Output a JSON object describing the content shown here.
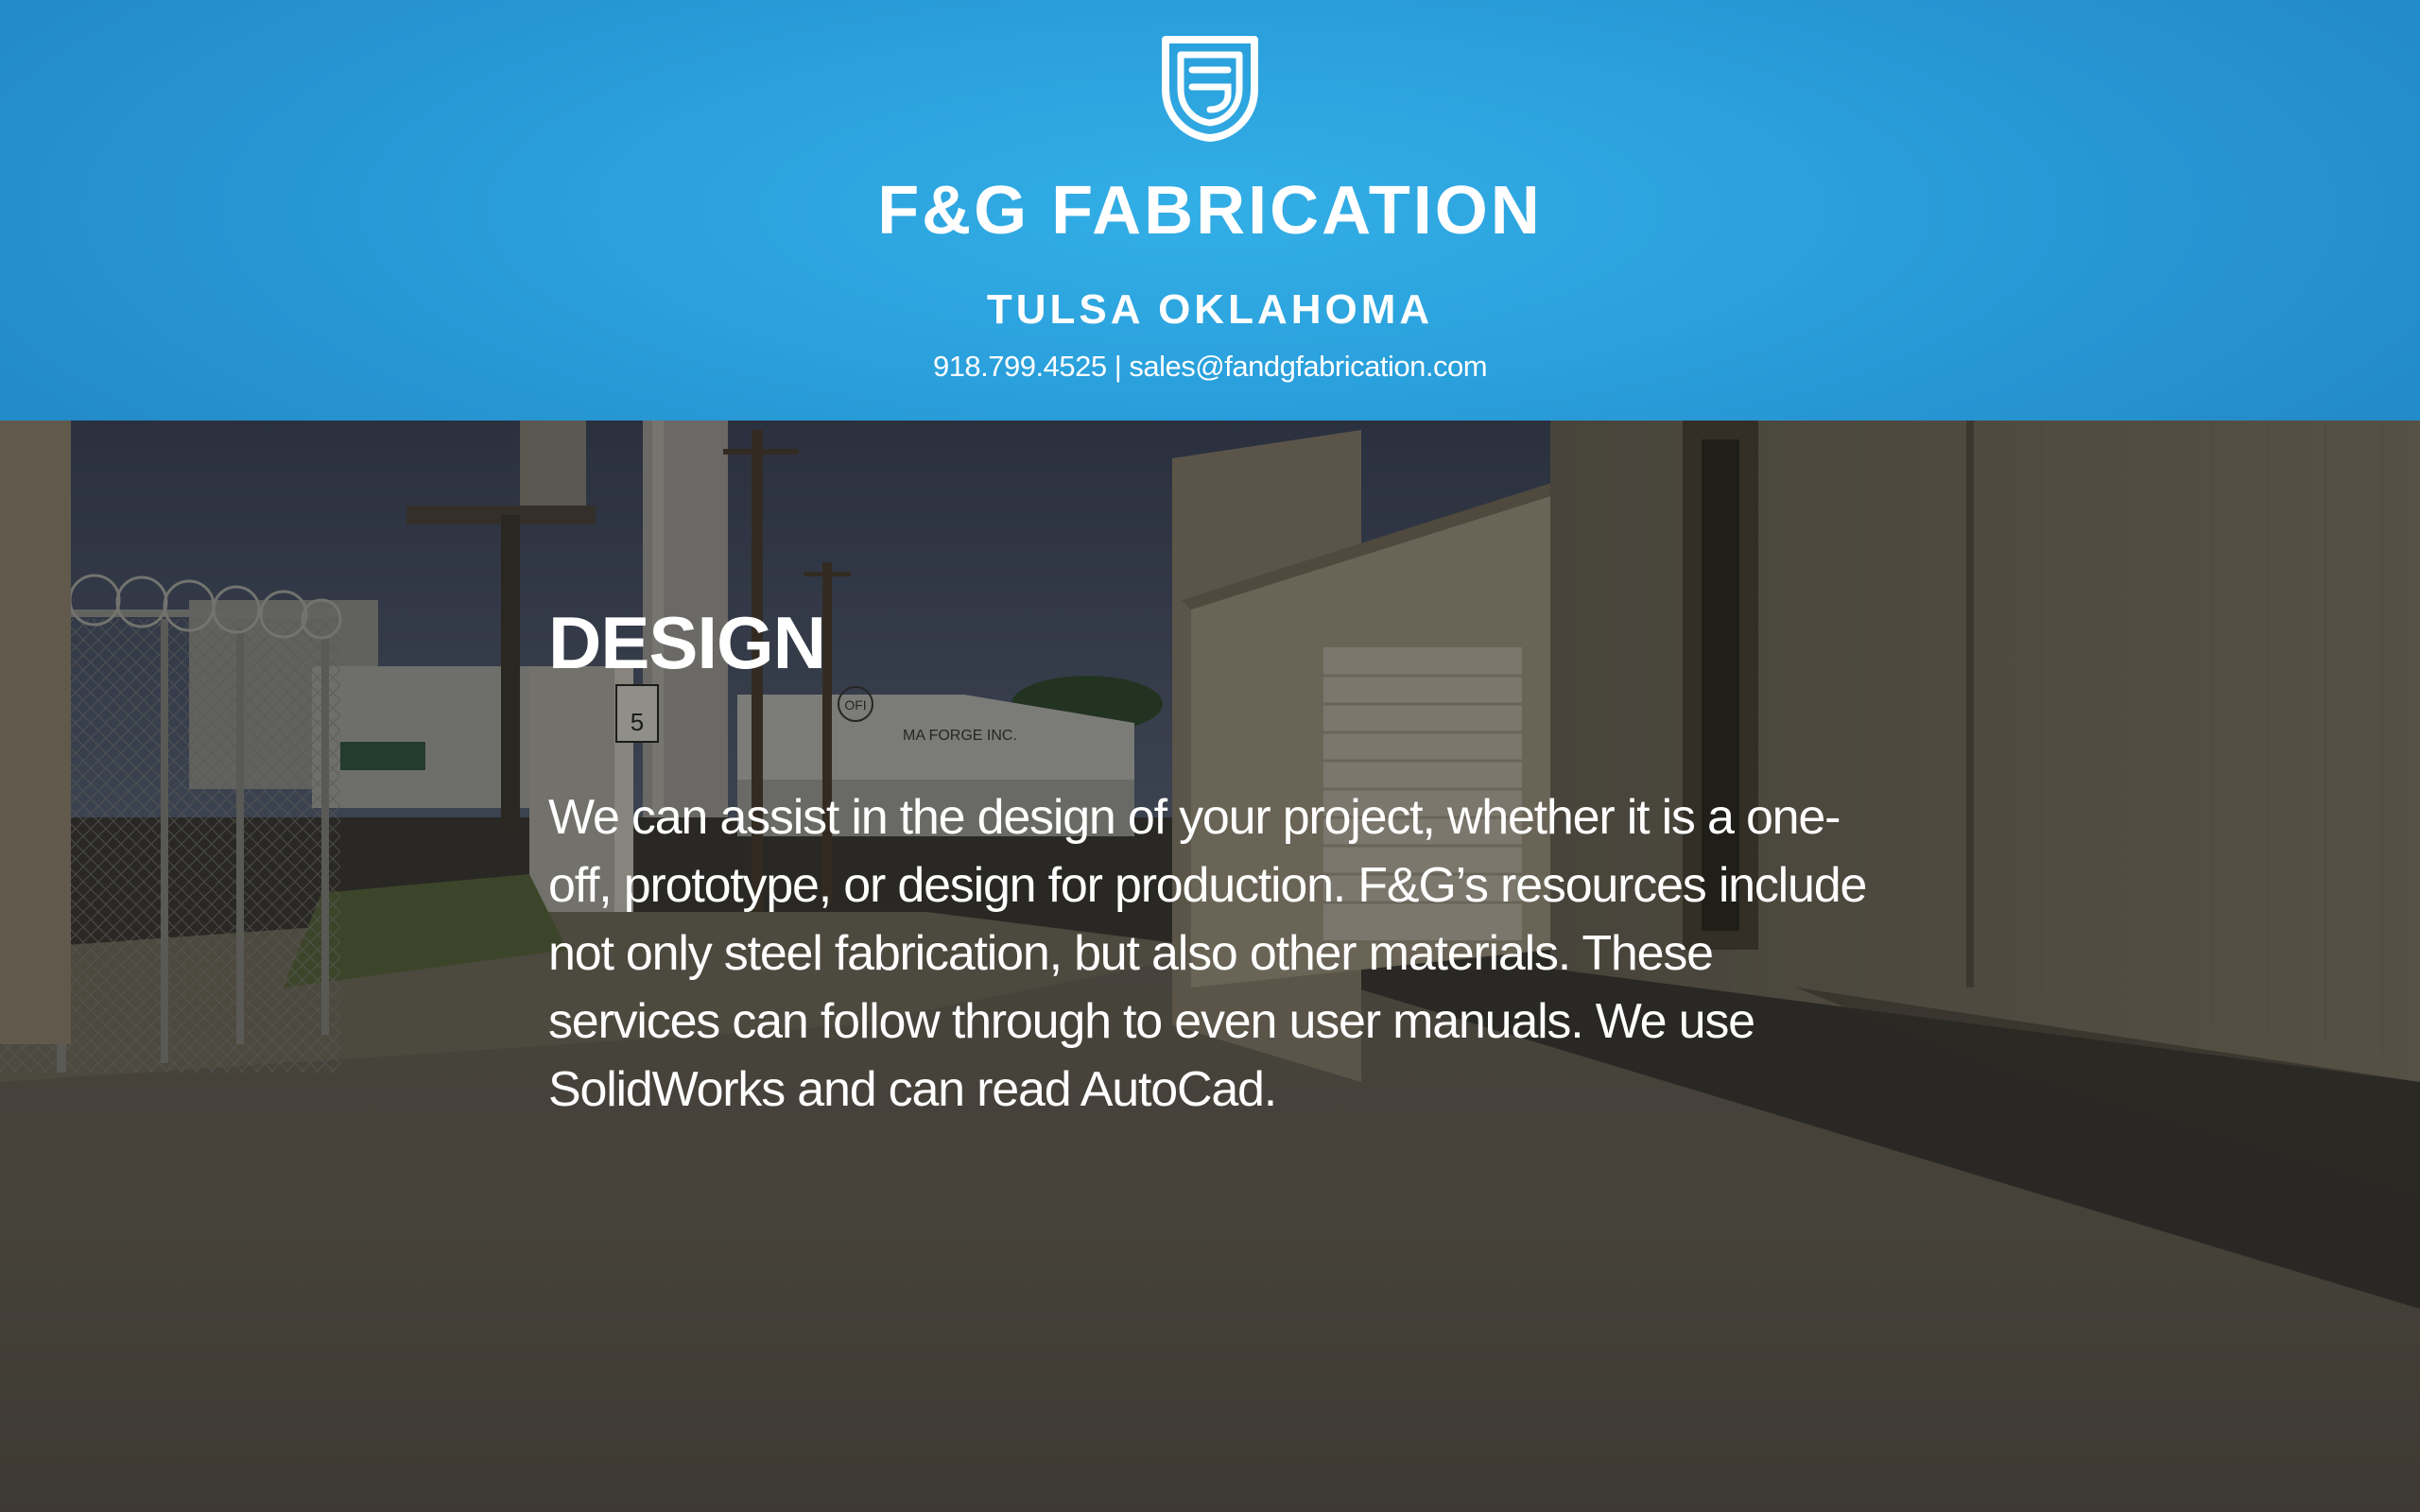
{
  "brand": {
    "name": "F&G FABRICATION",
    "location": "TULSA OKLAHOMA",
    "phone": "918.799.4525",
    "separator": "|",
    "email": "sales@fandgfabrication.com",
    "logo_icon": "fg-shield-logo-icon"
  },
  "section": {
    "title": "DESIGN",
    "body": "We can assist in the design of your project, whether it is a one-off, prototype, or design for production. F&G’s resources include not only steel fabrication, but also other materials. These services can follow through to even user manuals. We use SolidWorks and can read AutoCad."
  },
  "background_photo": {
    "sign_text": "5",
    "building_sign": "MA FORGE INC.",
    "building_logo": "OFI"
  },
  "colors": {
    "header_blue": "#2aa0dc",
    "text": "#ffffff"
  }
}
